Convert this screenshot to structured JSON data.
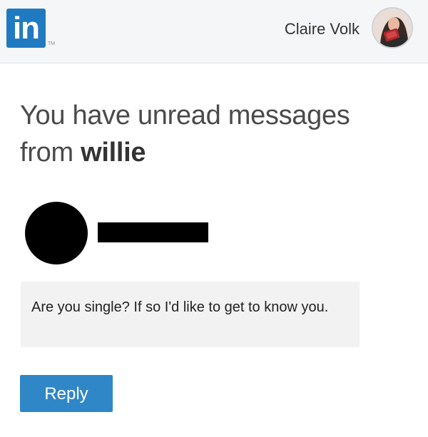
{
  "header": {
    "logo_text": "in",
    "logo_tm": "TM",
    "user_name": "Claire Volk",
    "avatar_icon": "profile-photo"
  },
  "notification": {
    "headline_prefix": "You have unread messages",
    "headline_from": "from",
    "sender": "willie"
  },
  "message": {
    "text": "Are you single? If so I'd like to get to know you."
  },
  "actions": {
    "reply_label": "Reply"
  },
  "colors": {
    "brand": "#1f7ac1",
    "button": "#2f87c8",
    "message_bg": "#f2f2f2",
    "header_bg": "#f5f6f8"
  }
}
